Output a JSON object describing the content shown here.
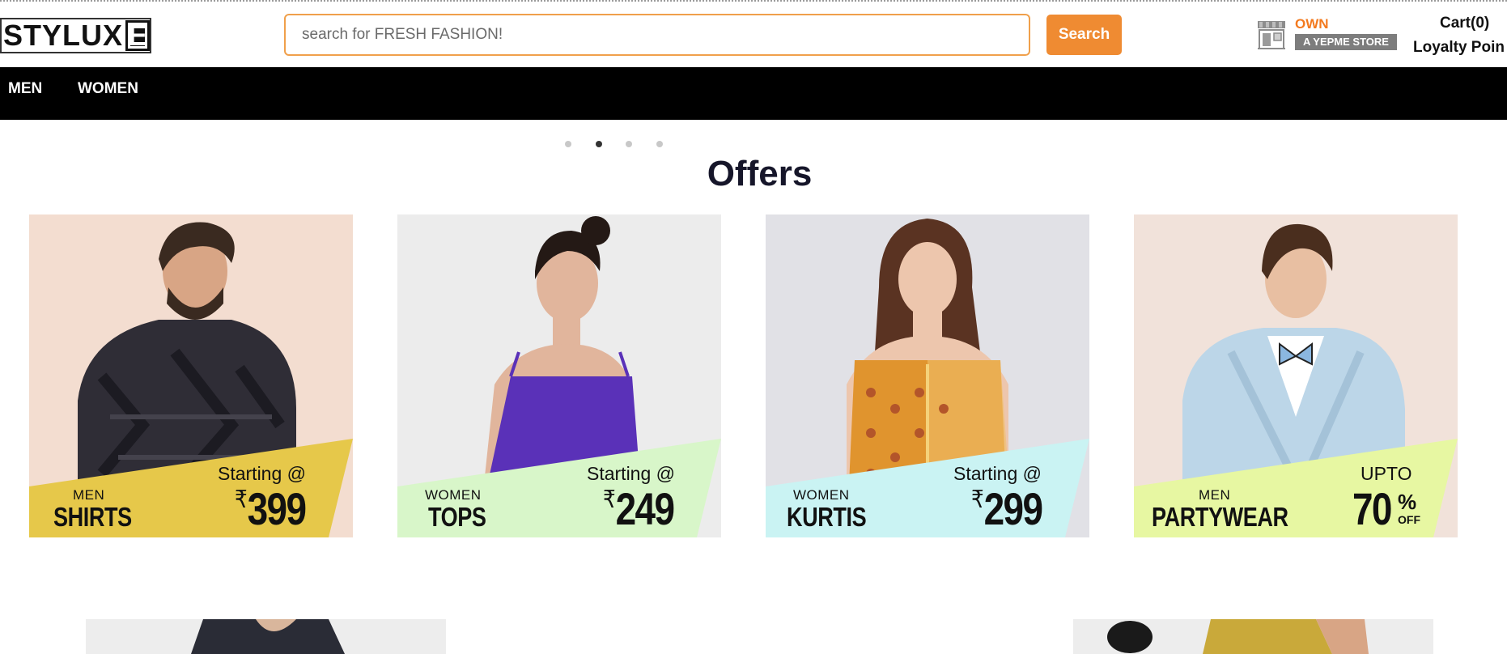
{
  "header": {
    "logo_text": "STYLUX",
    "logo_box_letter": "E",
    "search_placeholder": "search for FRESH FASHION!",
    "search_button": "Search",
    "store_own": "OWN",
    "store_label": "A YEPME STORE",
    "cart_label": "Cart(0)",
    "loyalty_label": "Loyalty Poin"
  },
  "nav": {
    "items": [
      {
        "label": "MEN"
      },
      {
        "label": "WOMEN"
      }
    ]
  },
  "carousel": {
    "dot_count": 4,
    "active_index": 1
  },
  "offers": {
    "title": "Offers",
    "cards": [
      {
        "category": "MEN",
        "product": "SHIRTS",
        "pre": "Starting @",
        "currency": "₹",
        "price": "399",
        "band_color": "#e6c84a",
        "bg": "#f3ddd0"
      },
      {
        "category": "WOMEN",
        "product": "TOPS",
        "pre": "Starting @",
        "currency": "₹",
        "price": "249",
        "band_color": "#d8f6c9",
        "bg": "#ececec"
      },
      {
        "category": "WOMEN",
        "product": "KURTIS",
        "pre": "Starting @",
        "currency": "₹",
        "price": "299",
        "band_color": "#caf3f3",
        "bg": "#e1e1e6"
      },
      {
        "category": "MEN",
        "product": "PARTYWEAR",
        "pre": "UPTO",
        "value": "70",
        "pct": "%",
        "off": "OFF",
        "band_color": "#e7f7a2",
        "bg": "#f1e2da"
      }
    ]
  },
  "icons": {
    "store": "store-icon"
  }
}
